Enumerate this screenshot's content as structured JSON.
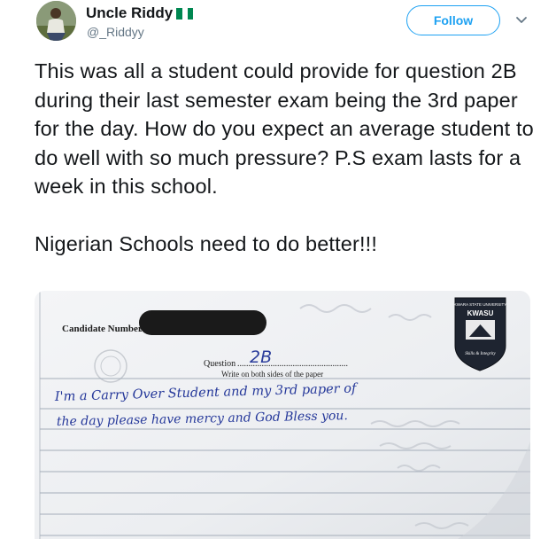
{
  "tweet": {
    "author": {
      "display_name": "Uncle Riddy",
      "flag_icon": "nigeria-flag-icon",
      "handle": "@_Riddyy"
    },
    "follow_label": "Follow",
    "menu_icon": "chevron-down-icon",
    "text": "This was all a student could provide for question 2B during their last semester exam being the 3rd paper for the day. How do you expect an average student to do well with so much pressure? P.S exam lasts for a week in this school.\n\nNigerian Schools need to do better!!!",
    "accent_color": "#1da1f2"
  },
  "photo": {
    "crest_top": "KWARA STATE UNIVERSITY",
    "crest_name": "KWASU",
    "crest_motto": "Skills & Integrity",
    "candidate_label": "Candidate Number",
    "question_label": "Question",
    "question_value": "2B",
    "instruction": "Write on both sides of the paper",
    "handwriting_line1": "I'm a Carry Over Student and my 3rd paper of",
    "handwriting_line2": "the day please have mercy and God Bless you."
  }
}
